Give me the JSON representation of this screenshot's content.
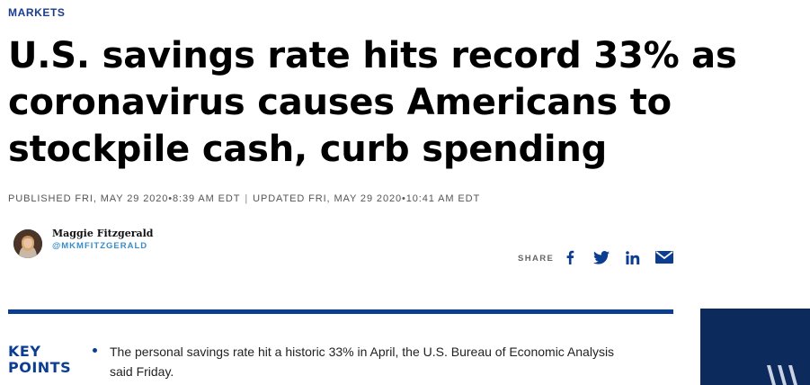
{
  "section": {
    "label": "MARKETS"
  },
  "article": {
    "headline_lines": [
      "U.S. savings rate hits record 33% as",
      "coronavirus causes Americans to",
      "stockpile cash, curb spending"
    ],
    "published": "PUBLISHED FRI, MAY 29 2020•8:39 AM EDT",
    "separator": "|",
    "updated": "UPDATED FRI, MAY 29 2020•10:41 AM EDT"
  },
  "author": {
    "name": "Maggie Fitzgerald",
    "handle": "@MKMFITZGERALD"
  },
  "share": {
    "label": "SHARE",
    "icons": [
      "facebook-icon",
      "twitter-icon",
      "linkedin-icon",
      "email-icon"
    ]
  },
  "key_points": {
    "label_line1": "KEY",
    "label_line2": "POINTS",
    "items": [
      "The personal savings rate hit a historic 33% in April, the U.S. Bureau of Economic Analysis said Friday."
    ]
  },
  "colors": {
    "accent": "#0b3d91",
    "section": "#1a3c8c",
    "handle": "#3a8cc8",
    "ad_background": "#0d2a5c"
  }
}
